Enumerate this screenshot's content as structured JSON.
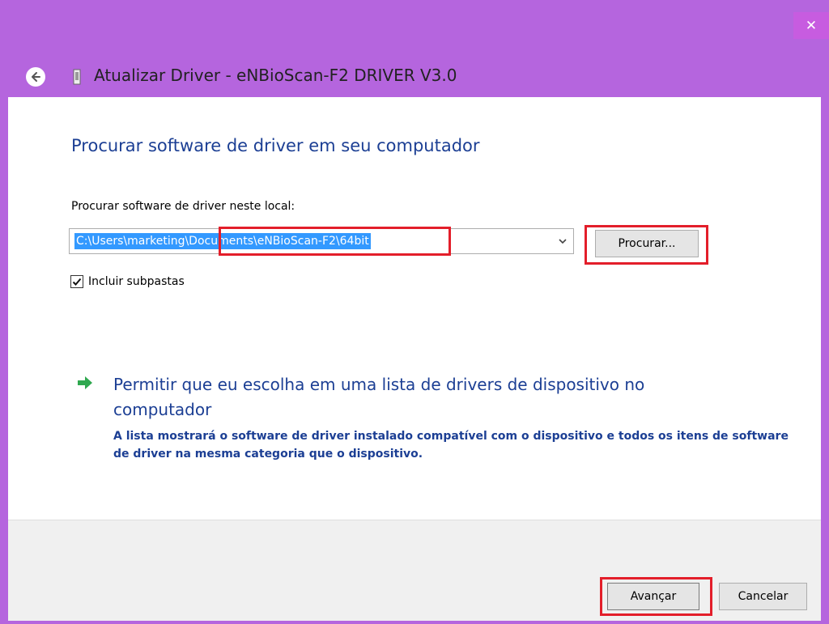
{
  "window": {
    "title": "Atualizar Driver -  eNBioScan-F2 DRIVER V3.0",
    "close_label": "✕",
    "accent_color": "#b565de"
  },
  "main": {
    "heading": "Procurar software de driver em seu computador",
    "location_label": "Procurar software de driver neste local:",
    "path_value": "C:\\Users\\marketing\\Documents\\eNBioScan-F2\\64bit",
    "browse_label": "Procurar...",
    "include_subfolders_label": "Incluir subpastas",
    "include_subfolders_checked": true,
    "pick_option": {
      "title": "Permitir que eu escolha em uma lista de drivers de dispositivo no computador",
      "description": "A lista mostrará o software de driver instalado compatível com o dispositivo e todos os itens de software de driver na mesma categoria que o dispositivo."
    }
  },
  "footer": {
    "next_label": "Avançar",
    "cancel_label": "Cancelar"
  },
  "icons": {
    "back": "back-arrow-icon",
    "device": "device-icon",
    "combo": "chevron-down-icon",
    "check": "checkmark-icon",
    "pick": "green-arrow-icon"
  },
  "colors": {
    "heading": "#1c3f94",
    "highlight": "#e31e2a",
    "selection": "#3399ff"
  }
}
